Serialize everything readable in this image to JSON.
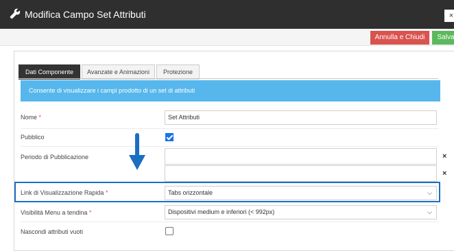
{
  "window": {
    "title": "Modifica Campo Set Attributi",
    "close_label": "×"
  },
  "actions": {
    "cancel_label": "Annulla e Chiudi",
    "save_label": "Salva",
    "cancel_color": "#d9534f",
    "save_color": "#5cb85c"
  },
  "tabs": [
    {
      "label": "Dati Componente",
      "active": true
    },
    {
      "label": "Avanzate e Animazioni",
      "active": false
    },
    {
      "label": "Protezione",
      "active": false
    }
  ],
  "info_text": "Consente di visualizzare i campi prodotto di un set di attributi",
  "form": {
    "nome": {
      "label": "Nome",
      "required": "*",
      "value": "Set Attributi"
    },
    "pubblico": {
      "label": "Pubblico",
      "checked": true
    },
    "periodo": {
      "label": "Periodo di Pubblicazione",
      "clear_label": "×"
    },
    "link": {
      "label": "Link di Visualizzazione Rapida",
      "required": "*",
      "value": "Tabs orizzontale"
    },
    "visibilita": {
      "label": "Visibilità Menu a tendina",
      "required": "*",
      "value": "Dispositivi medium e inferiori (< 992px)"
    },
    "nascondi": {
      "label": "Nascondi attributi vuoti",
      "checked": false
    }
  },
  "icons": {
    "title": "wrench-icon",
    "select": "chevron-down-icon",
    "clear": "close-icon",
    "arrow": "arrow-down-icon"
  },
  "colors": {
    "accent": "#1b6fc2",
    "info_bg": "#57b7ec",
    "titlebar_bg": "#2f2f2f"
  }
}
